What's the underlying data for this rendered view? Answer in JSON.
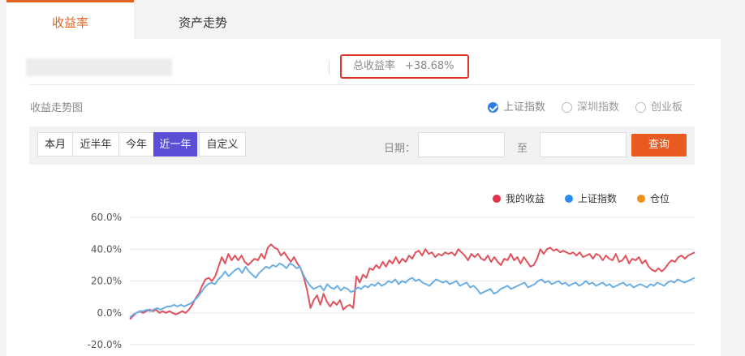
{
  "tabs": [
    {
      "label": "收益率",
      "active": true
    },
    {
      "label": "资产走势",
      "active": false
    }
  ],
  "total_return": {
    "label": "总收益率",
    "value": "+38.68%"
  },
  "section_title": "收益走势图",
  "benchmarks": [
    {
      "label": "上证指数",
      "checked": true
    },
    {
      "label": "深圳指数",
      "checked": false
    },
    {
      "label": "创业板",
      "checked": false
    }
  ],
  "periods": [
    {
      "label": "本月",
      "active": false
    },
    {
      "label": "近半年",
      "active": false
    },
    {
      "label": "今年",
      "active": false
    },
    {
      "label": "近一年",
      "active": true
    },
    {
      "label": "自定义",
      "active": false
    }
  ],
  "date_filter": {
    "label": "日期：",
    "to": "至",
    "from_value": "",
    "to_value": "",
    "query_label": "查询"
  },
  "colors": {
    "accent": "#e2621e",
    "my_return": "#e0525c",
    "sh_index": "#6aaee6",
    "position": "#f0901e",
    "active_period": "#5b4fd6",
    "query": "#e85a1f"
  },
  "chart_data": {
    "type": "line",
    "ylim": [
      -20,
      60
    ],
    "yticks": [
      60,
      40,
      20,
      0,
      -20
    ],
    "ytick_labels": [
      "60.0%",
      "40.0%",
      "20.0%",
      "0.0%",
      "-20.0%"
    ],
    "grid": true,
    "legend": "top-right",
    "series": [
      {
        "name": "我的收益",
        "color": "#e0525c",
        "values": [
          -4,
          -2,
          0,
          1,
          0,
          1,
          2,
          1,
          2,
          0,
          1,
          0,
          1,
          0,
          -1,
          0,
          1,
          0,
          2,
          5,
          9,
          12,
          17,
          21,
          22,
          20,
          23,
          29,
          35,
          31,
          37,
          33,
          36,
          33,
          36,
          32,
          30,
          32,
          34,
          33,
          37,
          34,
          41,
          43,
          41,
          40,
          36,
          38,
          35,
          32,
          35,
          31,
          28,
          22,
          14,
          3,
          8,
          11,
          5,
          12,
          7,
          4,
          7,
          5,
          8,
          2,
          4,
          5,
          3,
          23,
          19,
          24,
          22,
          28,
          27,
          30,
          28,
          32,
          29,
          33,
          31,
          35,
          31,
          34,
          32,
          36,
          34,
          38,
          39,
          36,
          40,
          37,
          38,
          35,
          37,
          36,
          38,
          37,
          38,
          36,
          40,
          38,
          36,
          33,
          37,
          35,
          37,
          34,
          33,
          36,
          32,
          35,
          32,
          30,
          34,
          33,
          37,
          33,
          35,
          31,
          35,
          32,
          29,
          30,
          34,
          40,
          37,
          40,
          41,
          39,
          40,
          38,
          39,
          38,
          37,
          38,
          36,
          38,
          35,
          36,
          37,
          34,
          37,
          36,
          33,
          36,
          34,
          33,
          37,
          32,
          33,
          36,
          31,
          34,
          33,
          35,
          31,
          33,
          29,
          27,
          26,
          28,
          26,
          28,
          31,
          33,
          32,
          35,
          36,
          34,
          36,
          37,
          38
        ]
      },
      {
        "name": "上证指数",
        "color": "#6aaee6",
        "values": [
          -3,
          -1,
          0,
          1,
          1,
          2,
          1,
          2,
          3,
          2,
          3,
          4,
          4,
          5,
          4,
          5,
          4,
          5,
          6,
          8,
          10,
          13,
          16,
          18,
          19,
          18,
          21,
          23,
          26,
          23,
          25,
          27,
          28,
          25,
          29,
          26,
          24,
          22,
          25,
          27,
          29,
          28,
          30,
          29,
          31,
          30,
          28,
          31,
          30,
          28,
          29,
          24,
          20,
          17,
          15,
          16,
          17,
          14,
          18,
          16,
          15,
          17,
          14,
          16,
          15,
          13,
          14,
          16,
          15,
          17,
          16,
          18,
          17,
          19,
          17,
          18,
          20,
          19,
          21,
          18,
          20,
          19,
          21,
          22,
          20,
          21,
          19,
          18,
          17,
          19,
          21,
          20,
          19,
          20,
          18,
          19,
          20,
          17,
          18,
          19,
          16,
          17,
          15,
          12,
          13,
          14,
          15,
          12,
          13,
          15,
          16,
          17,
          15,
          16,
          17,
          18,
          19,
          16,
          17,
          18,
          20,
          21,
          19,
          20,
          18,
          19,
          20,
          18,
          19,
          17,
          18,
          19,
          17,
          18,
          20,
          18,
          19,
          17,
          18,
          19,
          17,
          18,
          16,
          17,
          18,
          19,
          17,
          18,
          16,
          17,
          18,
          17,
          16,
          18,
          17,
          19,
          18,
          17,
          19,
          20,
          19,
          21,
          20,
          19,
          20,
          21,
          22
        ]
      },
      {
        "name": "仓位",
        "color": "#f0901e",
        "values": []
      }
    ]
  }
}
